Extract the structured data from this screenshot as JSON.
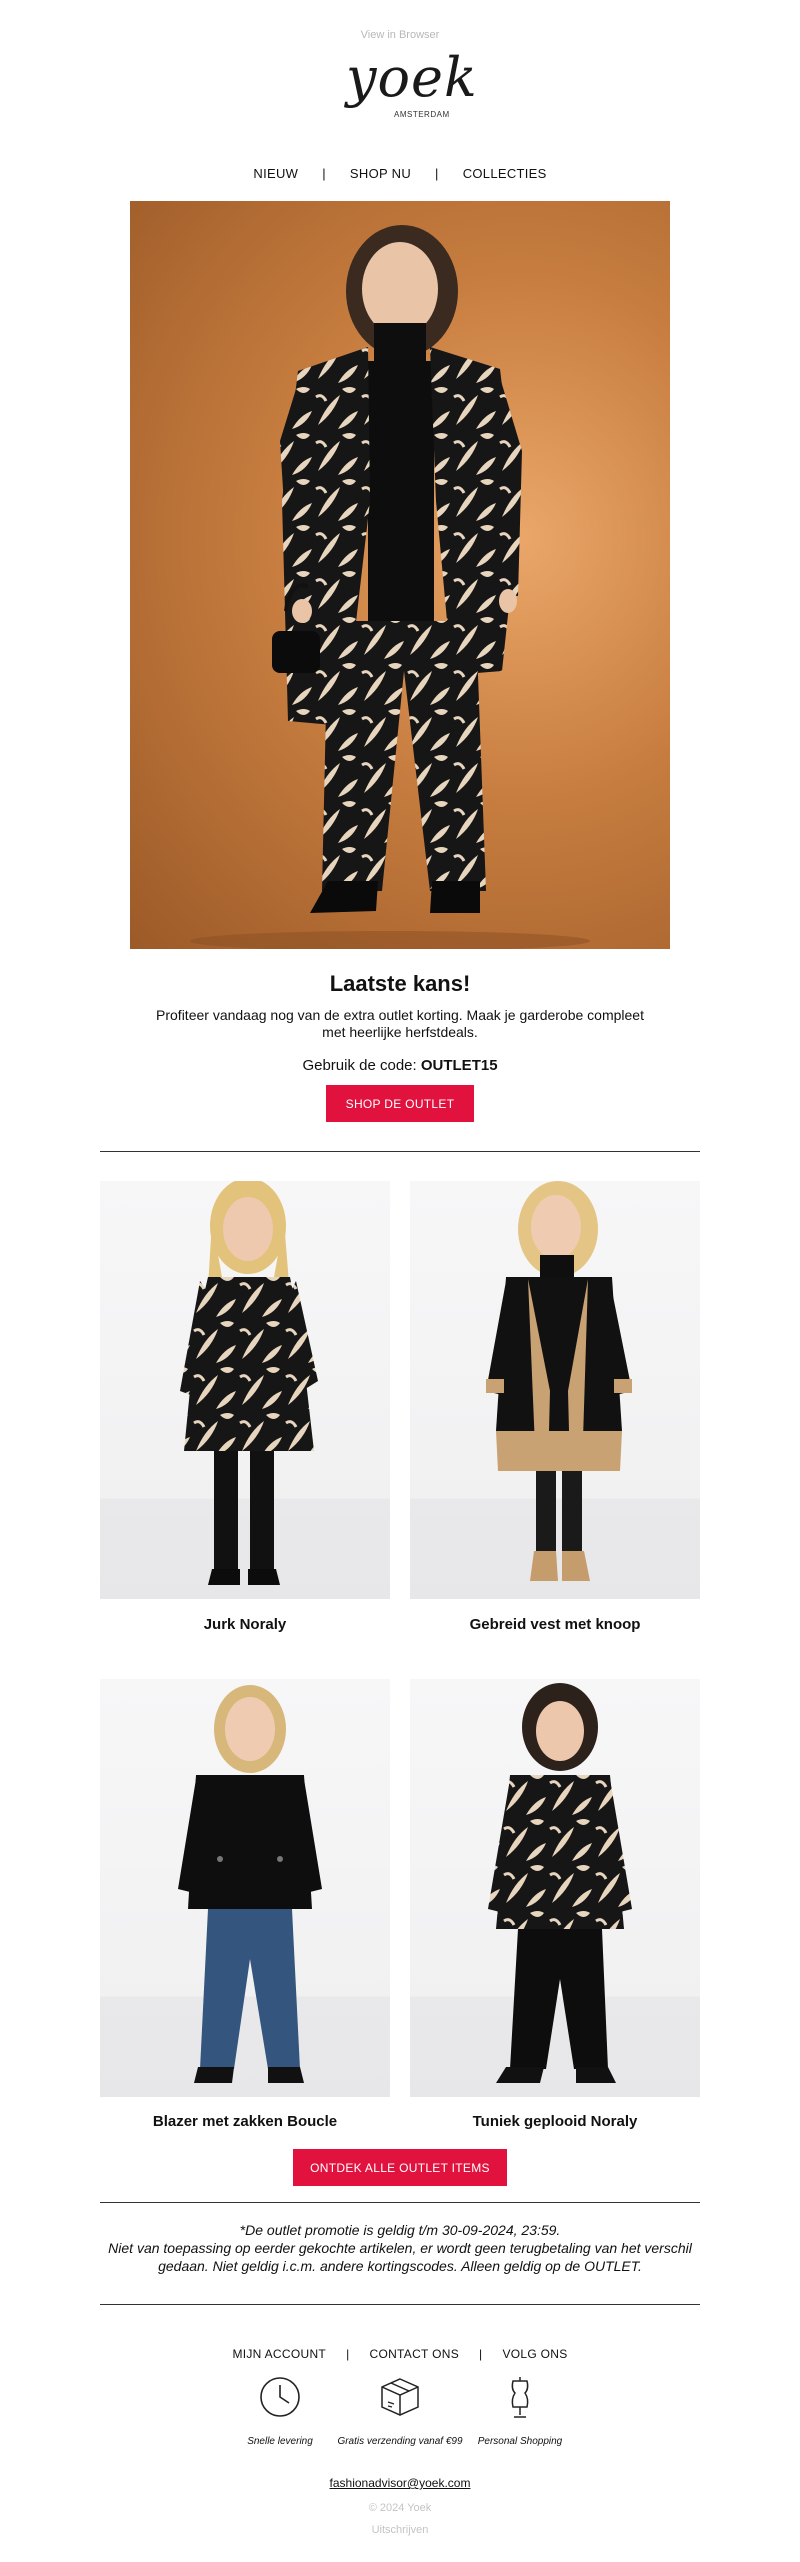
{
  "header": {
    "view_in_browser": "View in Browser",
    "logo": {
      "wordmark": "yoek",
      "subline": "AMSTERDAM"
    }
  },
  "top_nav": {
    "items": [
      "NIEUW",
      "SHOP NU",
      "COLLECTIES"
    ],
    "separator": "|"
  },
  "hero": {
    "image": "woman-in-black-and-cream-leaf-print-cardigan-and-wide-trousers-on-orange-backdrop"
  },
  "promo": {
    "headline": "Laatste kans!",
    "intro": "Profiteer vandaag nog van de extra outlet korting. Maak je garderobe compleet met heerlijke herfstdeals.",
    "code_prefix": "Gebruik de code:",
    "code": "OUTLET15",
    "cta": "SHOP DE OUTLET"
  },
  "products": [
    {
      "name": "Jurk Noraly",
      "image": "model-in-leaf-print-dress-and-black-boots"
    },
    {
      "name": "Gebreid vest met knoop",
      "image": "model-in-black-and-camel-long-cardigan"
    },
    {
      "name": "Blazer met zakken Boucle",
      "image": "model-in-black-blazer-and-blue-jeans"
    },
    {
      "name": "Tuniek geplooid Noraly",
      "image": "model-in-leaf-print-tunic-and-black-trousers"
    }
  ],
  "cta_all": "ONTDEK ALLE OUTLET ITEMS",
  "disclaimer": {
    "line1": "*De outlet promotie is geldig t/m 30-09-2024, 23:59.",
    "line2": "Niet van toepassing op eerder gekochte artikelen, er wordt geen terugbetaling van het verschil gedaan. Niet geldig i.c.m. andere kortingscodes. Alleen geldig op de OUTLET."
  },
  "footer": {
    "nav": [
      "MIJN ACCOUNT",
      "CONTACT ONS",
      "VOLG ONS"
    ],
    "separator": "|",
    "usps": [
      {
        "icon": "clock-icon",
        "label": "Snelle levering"
      },
      {
        "icon": "package-icon",
        "label": "Gratis verzending vanaf €99"
      },
      {
        "icon": "dress-form-icon",
        "label": "Personal Shopping"
      }
    ],
    "email": "fashionadvisor@yoek.com",
    "copyright": "© 2024 Yoek",
    "unsubscribe": "Uitschrijven"
  },
  "colors": {
    "accent": "#e2123f",
    "hero_background": "#c77d3f",
    "muted_text": "#b8b8b8"
  }
}
